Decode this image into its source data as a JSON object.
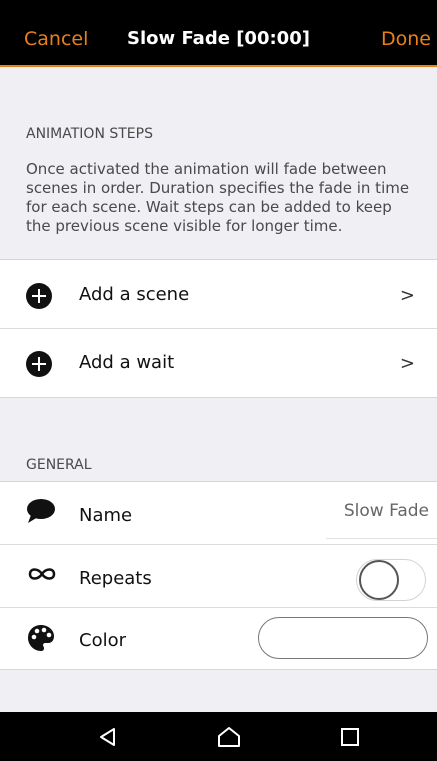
{
  "topbar": {
    "cancel_label": "Cancel",
    "title": "Slow Fade [00:00]",
    "done_label": "Done",
    "accent_color": "#e8801a"
  },
  "animation_steps": {
    "header": "ANIMATION STEPS",
    "description": "Once activated the animation will fade between scenes in order. Duration specifies the fade in time for each scene. Wait steps can be added to keep the previous scene visible for longer time.",
    "items": [
      {
        "label": "Add a scene",
        "icon": "plus-circle-icon",
        "chevron": ">"
      },
      {
        "label": "Add a wait",
        "icon": "plus-circle-icon",
        "chevron": ">"
      }
    ]
  },
  "general": {
    "header": "GENERAL",
    "name": {
      "label": "Name",
      "icon": "speech-bubble-icon",
      "value": "Slow Fade"
    },
    "repeats": {
      "label": "Repeats",
      "icon": "infinity-icon",
      "toggle_on": false
    },
    "color": {
      "label": "Color",
      "icon": "palette-icon",
      "swatch_color": "#ffffff"
    }
  },
  "navbar": {
    "buttons": [
      "back-icon",
      "home-icon",
      "recents-icon"
    ]
  }
}
